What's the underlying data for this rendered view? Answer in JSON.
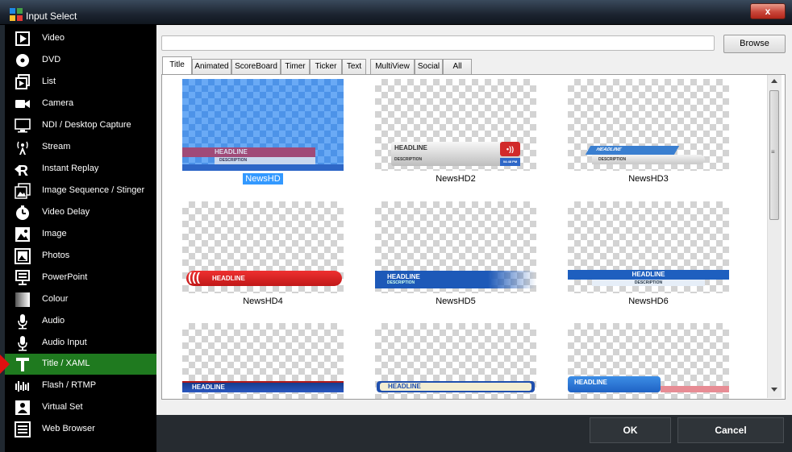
{
  "window": {
    "title": "Input Select",
    "close_label": "x"
  },
  "sidebar": {
    "items": [
      {
        "label": "Video",
        "icon": "video-icon"
      },
      {
        "label": "DVD",
        "icon": "dvd-icon"
      },
      {
        "label": "List",
        "icon": "list-icon"
      },
      {
        "label": "Camera",
        "icon": "camera-icon"
      },
      {
        "label": "NDI / Desktop Capture",
        "icon": "monitor-icon"
      },
      {
        "label": "Stream",
        "icon": "stream-icon"
      },
      {
        "label": "Instant Replay",
        "icon": "replay-icon"
      },
      {
        "label": "Image Sequence / Stinger",
        "icon": "image-sequence-icon"
      },
      {
        "label": "Video Delay",
        "icon": "delay-icon"
      },
      {
        "label": "Image",
        "icon": "image-icon"
      },
      {
        "label": "Photos",
        "icon": "photos-icon"
      },
      {
        "label": "PowerPoint",
        "icon": "powerpoint-icon"
      },
      {
        "label": "Colour",
        "icon": "colour-icon"
      },
      {
        "label": "Audio",
        "icon": "microphone-icon"
      },
      {
        "label": "Audio Input",
        "icon": "microphone-icon"
      },
      {
        "label": "Title / XAML",
        "icon": "title-icon",
        "selected": true
      },
      {
        "label": "Flash / RTMP",
        "icon": "flash-icon"
      },
      {
        "label": "Virtual Set",
        "icon": "virtual-set-icon"
      },
      {
        "label": "Web Browser",
        "icon": "web-browser-icon"
      }
    ]
  },
  "main": {
    "path_value": "",
    "browse_label": "Browse",
    "tabs": [
      {
        "label": "Title",
        "active": true
      },
      {
        "label": "Animated"
      },
      {
        "label": "ScoreBoard"
      },
      {
        "label": "Timer"
      },
      {
        "label": "Ticker"
      },
      {
        "label": "Text"
      },
      {
        "label": "MultiView"
      },
      {
        "label": "Social"
      },
      {
        "label": "All"
      }
    ],
    "templates": [
      {
        "name": "NewsHD",
        "selected": true,
        "headline": "HEADLINE",
        "description": "DESCRIPTION"
      },
      {
        "name": "NewsHD2",
        "headline": "HEADLINE",
        "description": "DESCRIPTION",
        "time": "04:48 PM"
      },
      {
        "name": "NewsHD3",
        "headline": "HEADLINE",
        "description": "DESCRIPTION"
      },
      {
        "name": "NewsHD4",
        "headline": "HEADLINE"
      },
      {
        "name": "NewsHD5",
        "headline": "HEADLINE",
        "description": "DESCRIPTION"
      },
      {
        "name": "NewsHD6",
        "headline": "HEADLINE",
        "description": "DESCRIPTION"
      },
      {
        "name": "",
        "headline": "HEADLINE"
      },
      {
        "name": "",
        "headline": "HEADLINE"
      },
      {
        "name": "",
        "headline": "HEADLINE"
      }
    ],
    "scroll_grip": "≡"
  },
  "footer": {
    "ok_label": "OK",
    "cancel_label": "Cancel"
  },
  "colors": {
    "selected_sidebar": "#1f7a1f",
    "selection_blue": "#3399ff",
    "footer_bg": "#262b30"
  }
}
